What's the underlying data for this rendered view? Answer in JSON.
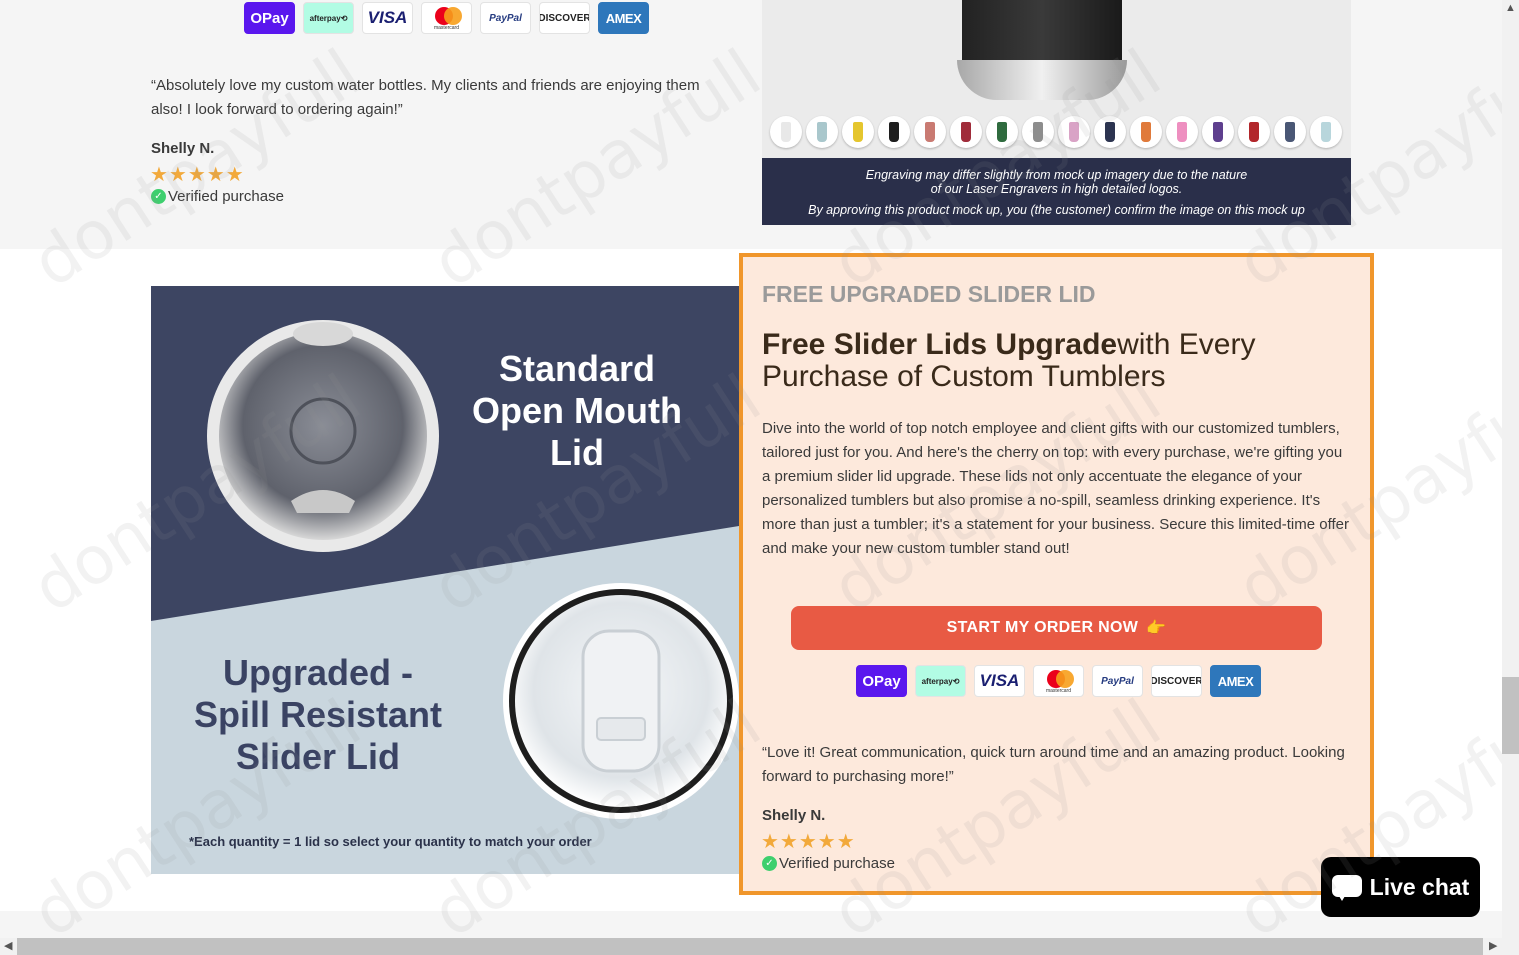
{
  "payment_methods": [
    "OPay",
    "afterpay⟲",
    "VISA",
    "mastercard",
    "PayPal",
    "DISCOVER",
    "AMEX"
  ],
  "top_review": {
    "quote": "“Absolutely love my custom water bottles. My clients and friends are enjoying them also! I look forward to ordering again!”",
    "reviewer": "Shelly N.",
    "stars": "★★★★★",
    "verified": "Verified purchase"
  },
  "product_image": {
    "caption_line1": "Engraving may differ slightly from mock up imagery due to the nature",
    "caption_line2": "of our Laser Engravers in high detailed logos.",
    "caption_line3": "By approving this product mock up, you (the customer) confirm the image on this mock up",
    "swatch_colors": [
      "#e8e8e8",
      "#a9c7cc",
      "#e5c62e",
      "#1e1e1e",
      "#c97a72",
      "#a02c3a",
      "#2f6b3e",
      "#8d8d8d",
      "#d9a3c6",
      "#2c3450",
      "#e07a3b",
      "#ee8fc0",
      "#5e3f8e",
      "#b2262b",
      "#4a5775",
      "#b8d6dc"
    ]
  },
  "lid_image": {
    "standard_line1": "Standard",
    "standard_line2": "Open Mouth",
    "standard_line3": "Lid",
    "upgraded_line1": "Upgraded -",
    "upgraded_line2": "Spill Resistant",
    "upgraded_line3": "Slider Lid",
    "note": "*Each quantity = 1 lid so select your quantity to match your order"
  },
  "promo": {
    "eyebrow": "FREE UPGRADED SLIDER LID",
    "heading_bold": "Free Slider Lids Upgrade",
    "heading_rest": "with Every Purchase of Custom Tumblers",
    "body": "Dive into the world of top notch employee and client gifts with our customized tumblers, tailored just for you. And here's the cherry on top: with every purchase, we're gifting you a premium slider lid upgrade. These lids not only accentuate the elegance of your personalized tumblers but also promise a no-spill, seamless drinking experience. It's more than just a tumbler; it's a statement for your business. Secure this limited-time offer and make your new custom tumbler stand out!",
    "cta_label": "START MY ORDER NOW",
    "cta_icon": "👉",
    "review": {
      "quote": "“Love it! Great communication, quick turn around time and an amazing product. Looking forward to purchasing more!”",
      "reviewer": "Shelly N.",
      "stars": "★★★★★",
      "verified": "Verified purchase"
    }
  },
  "chat": {
    "label": "Live chat"
  },
  "watermark": "dontpayfull",
  "colors": {
    "accent_orange": "#f0962b",
    "cta_red": "#e85a44",
    "promo_bg": "#fde9dc",
    "star": "#f2a93b",
    "verified_green": "#3ecf6e"
  }
}
